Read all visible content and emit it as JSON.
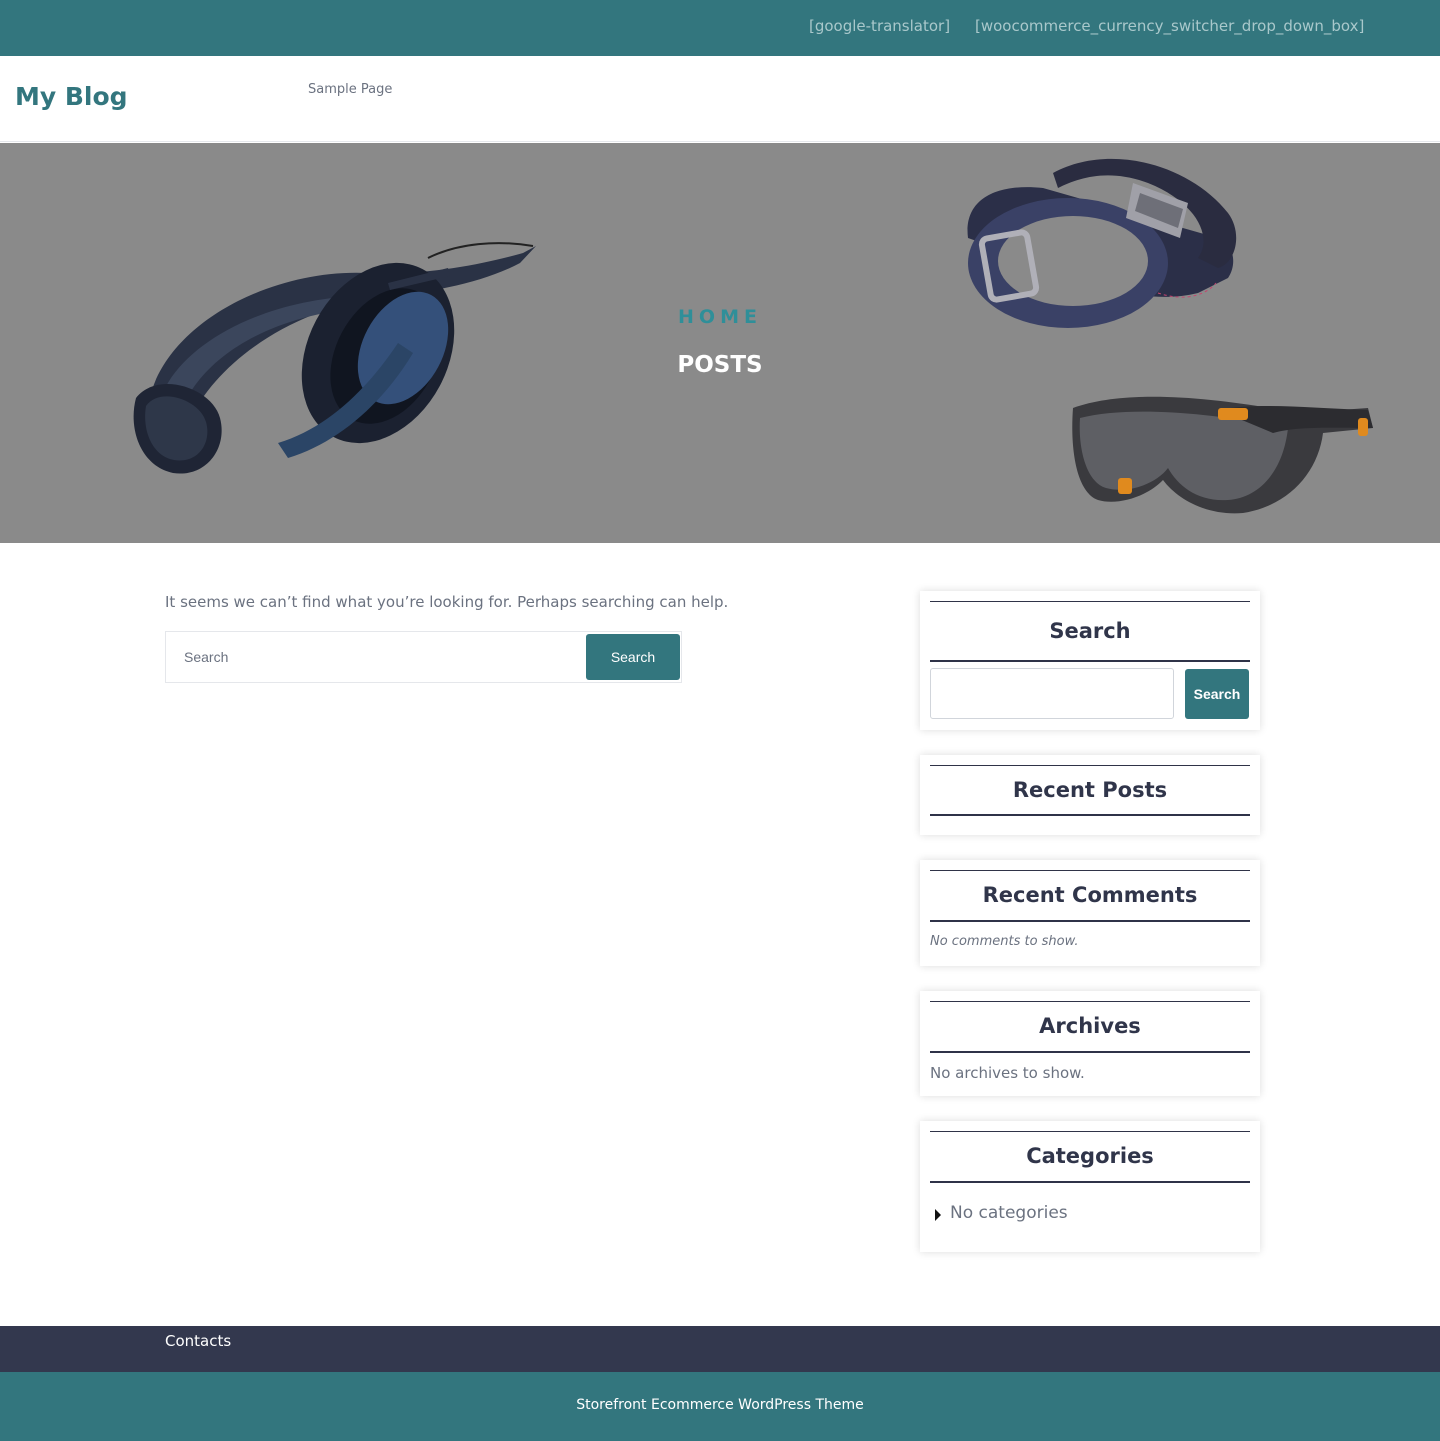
{
  "topbar": {
    "shortcode_translator": "[google-translator]",
    "shortcode_currency": "[woocommerce_currency_switcher_drop_down_box]"
  },
  "header": {
    "site_title": "My Blog",
    "nav": [
      "Sample Page"
    ]
  },
  "hero": {
    "breadcrumb": "HOME",
    "title": "POSTS",
    "images": [
      "headphones",
      "belts",
      "sunglasses"
    ]
  },
  "main": {
    "not_found_message": "It seems we can’t find what you’re looking for. Perhaps searching can help.",
    "search_placeholder": "Search",
    "search_button": "Search"
  },
  "sidebar": {
    "search": {
      "title": "Search",
      "button": "Search"
    },
    "recent_posts": {
      "title": "Recent Posts"
    },
    "recent_comments": {
      "title": "Recent Comments",
      "empty": "No comments to show."
    },
    "archives": {
      "title": "Archives",
      "empty": "No archives to show."
    },
    "categories": {
      "title": "Categories",
      "items": [
        "No categories"
      ]
    }
  },
  "footer": {
    "links": [
      "Contacts"
    ],
    "credit": "Storefront Ecommerce WordPress Theme"
  },
  "colors": {
    "primary_teal": "#33767e",
    "dark_navy": "#33384e",
    "hero_overlay": "#8a8a8a"
  }
}
